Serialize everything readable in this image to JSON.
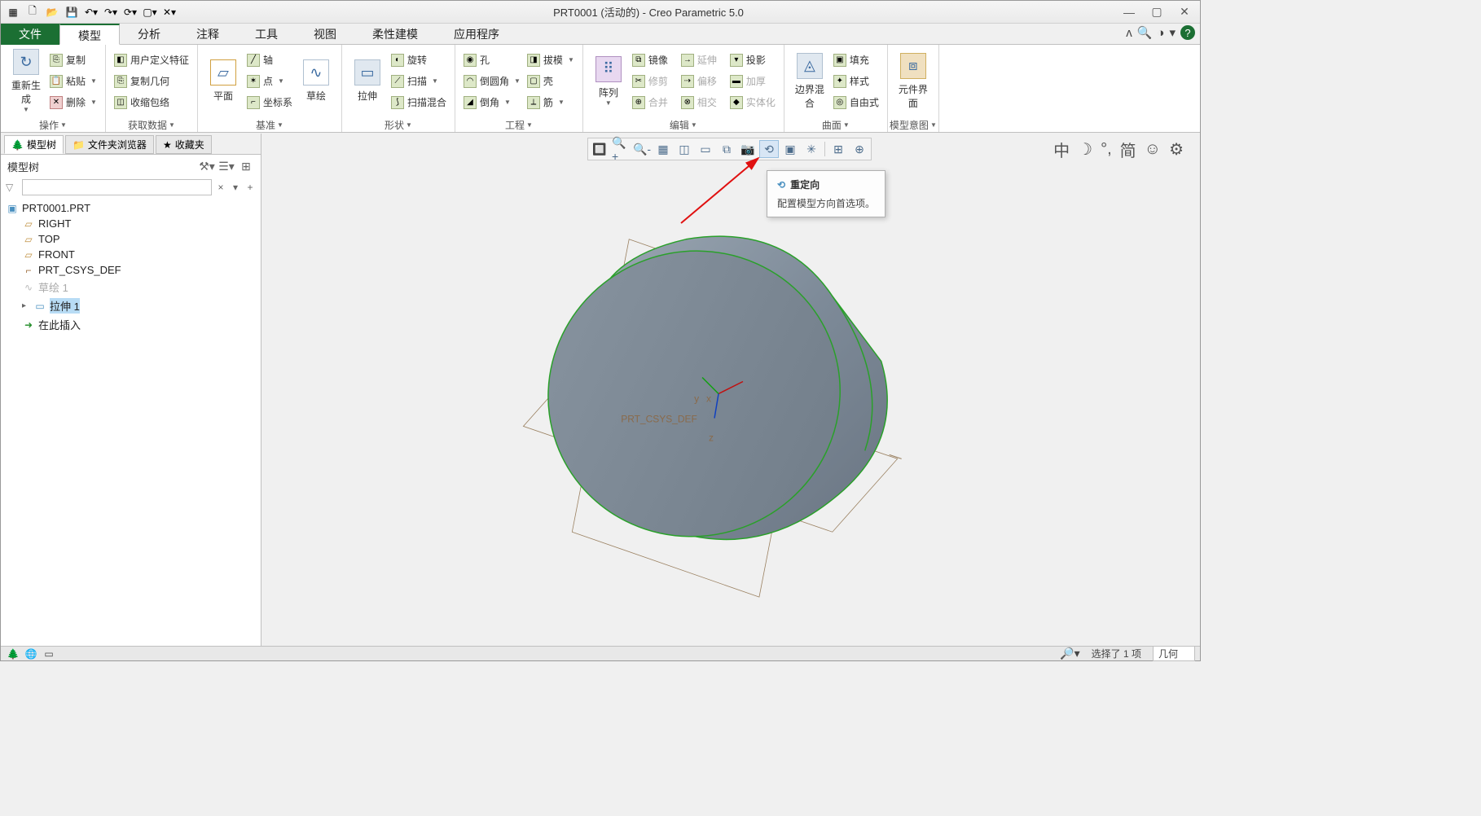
{
  "window": {
    "title": "PRT0001 (活动的) - Creo Parametric 5.0"
  },
  "menu": {
    "file": "文件",
    "tabs": [
      "模型",
      "分析",
      "注释",
      "工具",
      "视图",
      "柔性建模",
      "应用程序"
    ]
  },
  "ribbon": {
    "groups": [
      {
        "label": "操作",
        "big": [
          {
            "label": "重新生成",
            "icon": "↻"
          }
        ],
        "cols": [
          [
            {
              "label": "复制",
              "icon": "📋"
            },
            {
              "label": "粘贴",
              "icon": "📄",
              "dd": true
            },
            {
              "label": "删除",
              "icon": "✕",
              "dd": true
            }
          ]
        ]
      },
      {
        "label": "获取数据",
        "cols": [
          [
            {
              "label": "用户定义特征",
              "icon": "◧"
            },
            {
              "label": "复制几何",
              "icon": "⎘"
            },
            {
              "label": "收缩包络",
              "icon": "◫"
            }
          ]
        ]
      },
      {
        "label": "基准",
        "big": [
          {
            "label": "平面",
            "icon": "▱"
          },
          {
            "label": "草绘",
            "icon": "∿"
          }
        ],
        "cols": [
          [
            {
              "label": "轴",
              "icon": "╱"
            },
            {
              "label": "点",
              "icon": "✶",
              "dd": true
            },
            {
              "label": "坐标系",
              "icon": "⌐"
            }
          ]
        ]
      },
      {
        "label": "形状",
        "big": [
          {
            "label": "拉伸",
            "icon": "▭"
          }
        ],
        "cols": [
          [
            {
              "label": "旋转",
              "icon": "◐"
            },
            {
              "label": "扫描",
              "icon": "⟋",
              "dd": true
            },
            {
              "label": "扫描混合",
              "icon": "⟆"
            }
          ]
        ]
      },
      {
        "label": "工程",
        "cols": [
          [
            {
              "label": "孔",
              "icon": "◉"
            },
            {
              "label": "倒圆角",
              "icon": "◠",
              "dd": true
            },
            {
              "label": "倒角",
              "icon": "◢",
              "dd": true
            }
          ],
          [
            {
              "label": "拔模",
              "icon": "◨",
              "dd": true
            },
            {
              "label": "壳",
              "icon": "▢"
            },
            {
              "label": "筋",
              "icon": "⟂",
              "dd": true
            }
          ]
        ]
      },
      {
        "label": "编辑",
        "big": [
          {
            "label": "阵列",
            "icon": "⠿",
            "dd": true
          }
        ],
        "cols": [
          [
            {
              "label": "镜像",
              "icon": "⧉"
            },
            {
              "label": "修剪",
              "icon": "✂",
              "disabled": true
            },
            {
              "label": "合并",
              "icon": "⊕",
              "disabled": true
            }
          ],
          [
            {
              "label": "延伸",
              "icon": "→",
              "disabled": true
            },
            {
              "label": "偏移",
              "icon": "⇢",
              "disabled": true
            },
            {
              "label": "相交",
              "icon": "⊗",
              "disabled": true
            }
          ],
          [
            {
              "label": "投影",
              "icon": "▾"
            },
            {
              "label": "加厚",
              "icon": "▬",
              "disabled": true
            },
            {
              "label": "实体化",
              "icon": "◆",
              "disabled": true
            }
          ]
        ]
      },
      {
        "label": "曲面",
        "big": [
          {
            "label": "边界混合",
            "icon": "◬"
          }
        ],
        "cols": [
          [
            {
              "label": "填充",
              "icon": "▣"
            },
            {
              "label": "样式",
              "icon": "✦"
            },
            {
              "label": "自由式",
              "icon": "◎"
            }
          ]
        ]
      },
      {
        "label": "模型意图",
        "big": [
          {
            "label": "元件界面",
            "icon": "⧈"
          }
        ]
      }
    ]
  },
  "sidebar": {
    "tabs": [
      {
        "label": "模型树",
        "active": true
      },
      {
        "label": "文件夹浏览器"
      },
      {
        "label": "收藏夹"
      }
    ],
    "title": "模型树",
    "tree": {
      "root": "PRT0001.PRT",
      "items": [
        {
          "label": "RIGHT",
          "type": "plane"
        },
        {
          "label": "TOP",
          "type": "plane"
        },
        {
          "label": "FRONT",
          "type": "plane"
        },
        {
          "label": "PRT_CSYS_DEF",
          "type": "csys"
        },
        {
          "label": "草绘 1",
          "type": "sketch",
          "dim": true
        },
        {
          "label": "拉伸 1",
          "type": "extrude",
          "sel": true,
          "expandable": true
        },
        {
          "label": "在此插入",
          "type": "insert",
          "lvl": 2
        }
      ]
    }
  },
  "tooltip": {
    "title": "重定向",
    "desc": "配置模型方向首选项。"
  },
  "viewport": {
    "csys_label": "PRT_CSYS_DEF",
    "axis_x": "x",
    "axis_y": "y",
    "axis_z": "z"
  },
  "statusbar": {
    "selection": "选择了 1 项",
    "filter": "几何"
  }
}
